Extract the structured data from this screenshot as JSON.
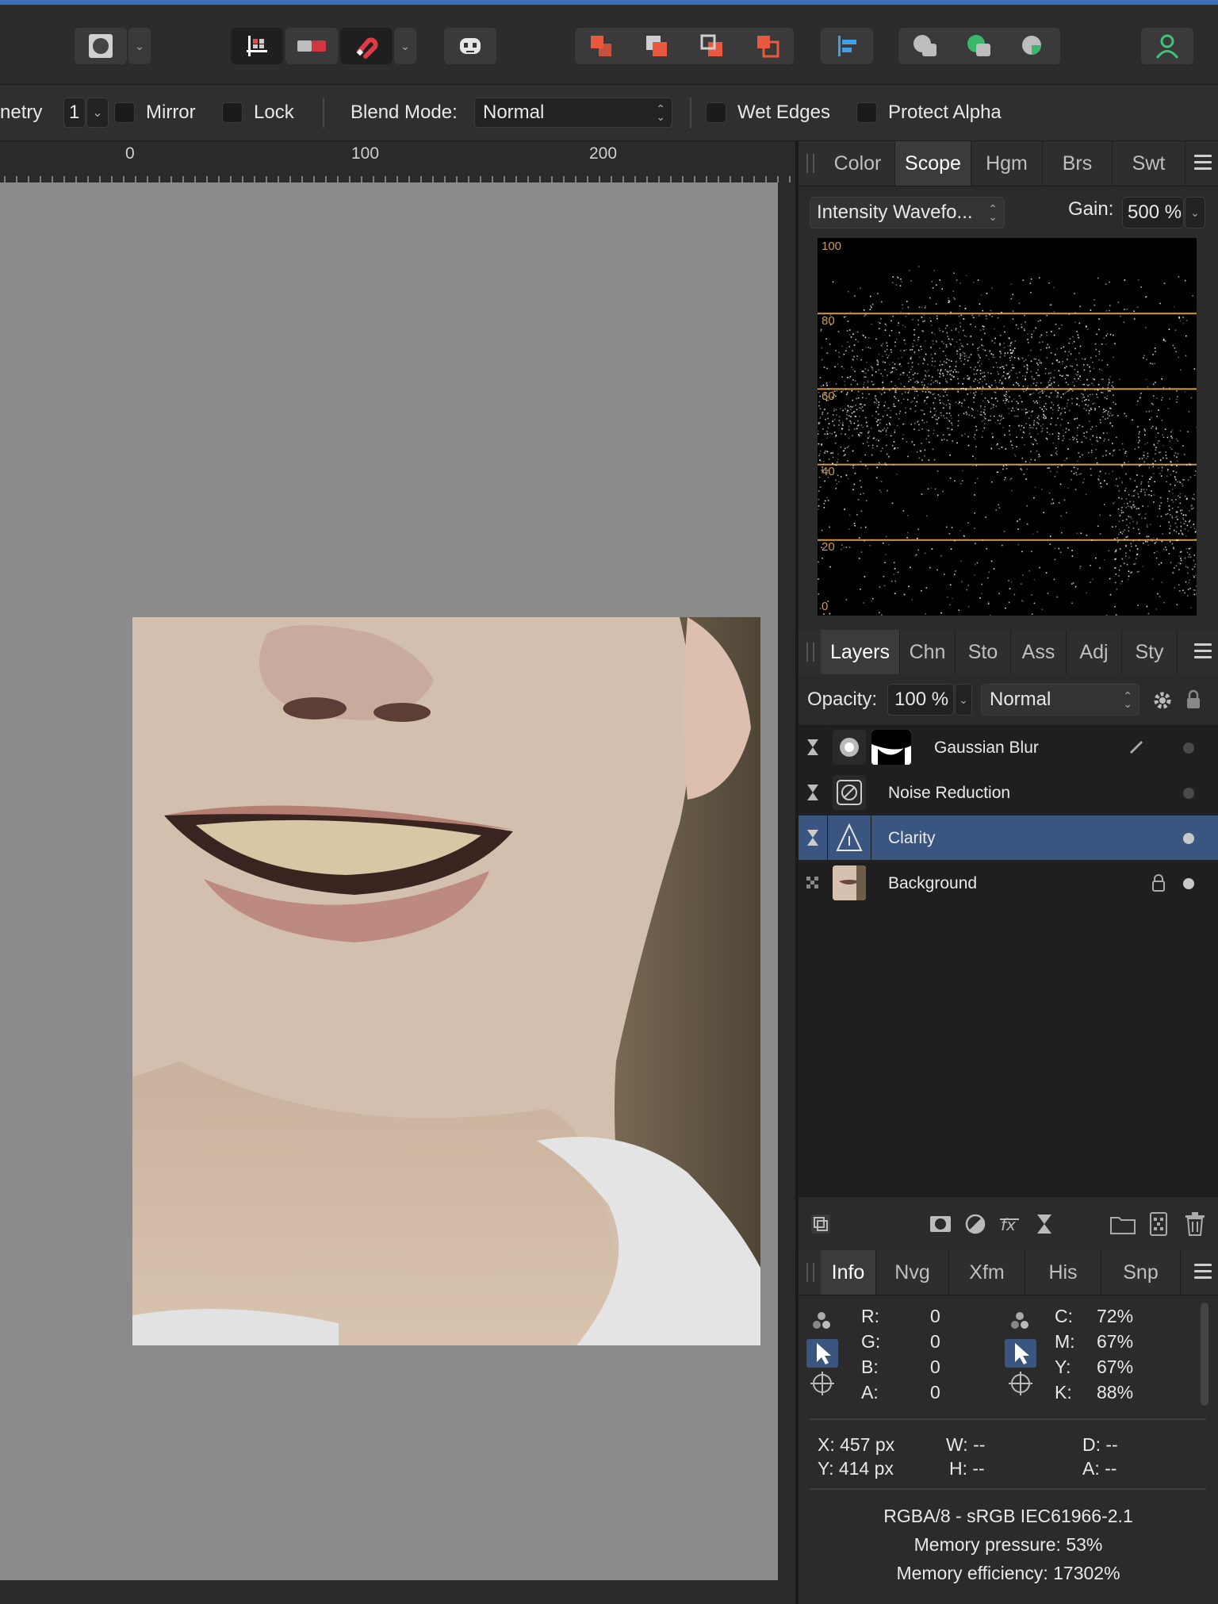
{
  "toolbar": {
    "buttons": [
      "mask-mode-icon",
      "snapping-grid-icon",
      "red-toggle-icon",
      "magnet-snapping-icon",
      "assistant-icon",
      "arrange-back-icon",
      "arrange-backward-icon",
      "arrange-forward-icon",
      "arrange-front-icon",
      "align-left-icon",
      "boolean-add-icon",
      "boolean-subtract-icon",
      "boolean-intersect-icon",
      "user-account-icon"
    ]
  },
  "context": {
    "symmetry_label": "netry",
    "symmetry_value": "1",
    "mirror_label": "Mirror",
    "lock_label": "Lock",
    "blend_mode_label": "Blend Mode:",
    "blend_mode_value": "Normal",
    "wet_edges_label": "Wet Edges",
    "protect_alpha_label": "Protect Alpha"
  },
  "ruler": {
    "labels": [
      "0",
      "100",
      "200"
    ]
  },
  "scope_panel": {
    "tabs": [
      "Color",
      "Scope",
      "Hgm",
      "Brs",
      "Swt"
    ],
    "active_tab": "Scope",
    "mode_value": "Intensity Wavefo...",
    "gain_label": "Gain:",
    "gain_value": "500 %",
    "scale_labels": [
      "100",
      "80",
      "60",
      "40",
      "20",
      "0"
    ],
    "guide_color": "#d49a4a"
  },
  "layers_panel": {
    "tabs": [
      "Layers",
      "Chn",
      "Sto",
      "Ass",
      "Adj",
      "Sty"
    ],
    "active_tab": "Layers",
    "opacity_label": "Opacity:",
    "opacity_value": "100 %",
    "blend_value": "Normal",
    "layers": [
      {
        "name": "Gaussian Blur",
        "selected": false
      },
      {
        "name": "Noise Reduction",
        "selected": false
      },
      {
        "name": "Clarity",
        "selected": true
      },
      {
        "name": "Background",
        "selected": false,
        "locked": true
      }
    ],
    "selection_color": "#3a5680"
  },
  "info_panel": {
    "tabs": [
      "Info",
      "Nvg",
      "Xfm",
      "His",
      "Snp"
    ],
    "active_tab": "Info",
    "rgba": [
      {
        "k": "R:",
        "v": "0"
      },
      {
        "k": "G:",
        "v": "0"
      },
      {
        "k": "B:",
        "v": "0"
      },
      {
        "k": "A:",
        "v": "0"
      }
    ],
    "cmyk": [
      {
        "k": "C:",
        "v": "72%"
      },
      {
        "k": "M:",
        "v": "67%"
      },
      {
        "k": "Y:",
        "v": "67%"
      },
      {
        "k": "K:",
        "v": "88%"
      }
    ],
    "x": "X: 457 px",
    "y": "Y: 414 px",
    "w": "W: --",
    "h": "H: --",
    "d": "D: --",
    "a": "A: --",
    "format": "RGBA/8 - sRGB IEC61966-2.1",
    "memory_pressure": "Memory pressure: 53%",
    "memory_efficiency": "Memory efficiency: 17302%"
  }
}
